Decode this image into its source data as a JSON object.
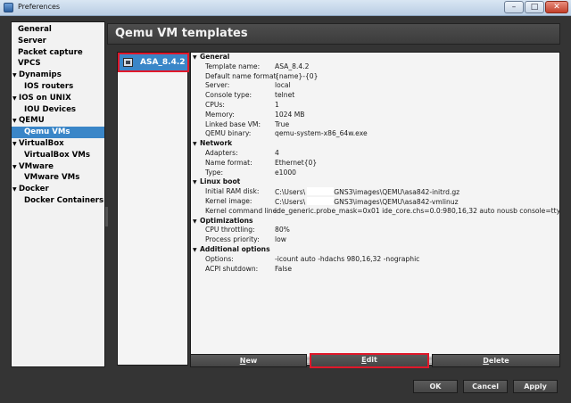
{
  "window": {
    "title": "Preferences"
  },
  "sidebar": {
    "items": [
      {
        "label": "General",
        "level": 0,
        "expander": false,
        "selected": false
      },
      {
        "label": "Server",
        "level": 0,
        "expander": false,
        "selected": false
      },
      {
        "label": "Packet capture",
        "level": 0,
        "expander": false,
        "selected": false
      },
      {
        "label": "VPCS",
        "level": 0,
        "expander": false,
        "selected": false
      },
      {
        "label": "Dynamips",
        "level": 0,
        "expander": true,
        "selected": false
      },
      {
        "label": "IOS routers",
        "level": 1,
        "expander": false,
        "selected": false
      },
      {
        "label": "IOS on UNIX",
        "level": 0,
        "expander": true,
        "selected": false
      },
      {
        "label": "IOU Devices",
        "level": 1,
        "expander": false,
        "selected": false
      },
      {
        "label": "QEMU",
        "level": 0,
        "expander": true,
        "selected": false
      },
      {
        "label": "Qemu VMs",
        "level": 1,
        "expander": false,
        "selected": true
      },
      {
        "label": "VirtualBox",
        "level": 0,
        "expander": true,
        "selected": false
      },
      {
        "label": "VirtualBox VMs",
        "level": 1,
        "expander": false,
        "selected": false
      },
      {
        "label": "VMware",
        "level": 0,
        "expander": true,
        "selected": false
      },
      {
        "label": "VMware VMs",
        "level": 1,
        "expander": false,
        "selected": false
      },
      {
        "label": "Docker",
        "level": 0,
        "expander": true,
        "selected": false
      },
      {
        "label": "Docker Containers",
        "level": 1,
        "expander": false,
        "selected": false
      }
    ]
  },
  "panel": {
    "title": "Qemu VM templates",
    "templates": [
      {
        "name": "ASA_8.4.2",
        "selected": true
      }
    ]
  },
  "details": {
    "sections": [
      {
        "title": "General",
        "props": [
          {
            "key": "Template name:",
            "value": "ASA_8.4.2"
          },
          {
            "key": "Default name format:",
            "value": "{name}-{0}"
          },
          {
            "key": "Server:",
            "value": "local"
          },
          {
            "key": "Console type:",
            "value": "telnet"
          },
          {
            "key": "CPUs:",
            "value": "1"
          },
          {
            "key": "Memory:",
            "value": "1024 MB"
          },
          {
            "key": "Linked base VM:",
            "value": "True"
          },
          {
            "key": "QEMU binary:",
            "value": "qemu-system-x86_64w.exe"
          }
        ]
      },
      {
        "title": "Network",
        "props": [
          {
            "key": "Adapters:",
            "value": "4"
          },
          {
            "key": "Name format:",
            "value": "Ethernet{0}"
          },
          {
            "key": "Type:",
            "value": "e1000"
          }
        ]
      },
      {
        "title": "Linux boot",
        "props": [
          {
            "key": "Initial RAM disk:",
            "value": "C:\\Users\\",
            "redacted": true,
            "value2": "GNS3\\images\\QEMU\\asa842-initrd.gz"
          },
          {
            "key": "Kernel image:",
            "value": "C:\\Users\\",
            "redacted": true,
            "value2": "GNS3\\images\\QEMU\\asa842-vmlinuz"
          },
          {
            "key": "Kernel command line:",
            "value": "ide_generic.probe_mask=0x01 ide_core.chs=0.0:980,16,32 auto nousb console=ttyS0,9600 b"
          }
        ]
      },
      {
        "title": "Optimizations",
        "props": [
          {
            "key": "CPU throttling:",
            "value": "80%"
          },
          {
            "key": "Process priority:",
            "value": "low"
          }
        ]
      },
      {
        "title": "Additional options",
        "props": [
          {
            "key": "Options:",
            "value": "-icount auto -hdachs 980,16,32 -nographic"
          },
          {
            "key": "ACPI shutdown:",
            "value": "False"
          }
        ]
      }
    ]
  },
  "buttons": {
    "new": {
      "first": "N",
      "rest": "ew"
    },
    "edit": {
      "first": "E",
      "rest": "dit"
    },
    "delete": {
      "first": "D",
      "rest": "elete"
    },
    "ok": "OK",
    "cancel": "Cancel",
    "apply": "Apply"
  }
}
